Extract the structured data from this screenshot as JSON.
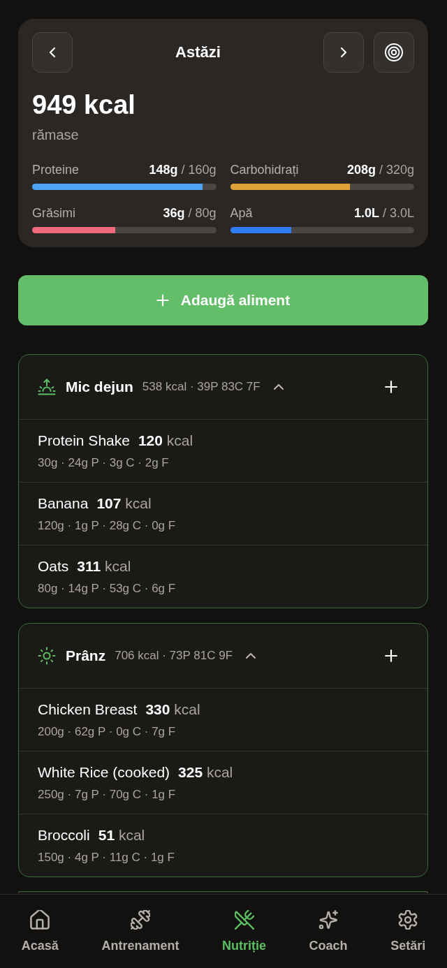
{
  "header": {
    "title": "Astăzi",
    "calories_remaining": "949 kcal",
    "remaining_label": "rămase"
  },
  "macros": [
    {
      "name": "Proteine",
      "value": "**148g** / 160g",
      "level": 0.925,
      "color": "#4da3f5"
    },
    {
      "name": "Carbohidrați",
      "value": "**208g** / 320g",
      "level": 0.65,
      "color": "#e1a237"
    },
    {
      "name": "Grăsimi",
      "value": "**36g** / 80g",
      "level": 0.45,
      "color": "#f2687d"
    },
    {
      "name": "Apă",
      "value": "**1.0L** / 3.0L",
      "level": 0.333,
      "color": "#2f7cf6"
    }
  ],
  "add_button": {
    "label": "Adaugă aliment"
  },
  "meals": [
    {
      "kind": "breakfast",
      "name": "Mic dejun",
      "summary": "538 kcal · 39P 83C 7F",
      "expanded": true,
      "items": [
        {
          "name": "Protein Shake",
          "calories": "**120** kcal",
          "details": "30g · 24g P · 3g C · 2g F"
        },
        {
          "name": "Banana",
          "calories": "**107** kcal",
          "details": "120g · 1g P · 28g C · 0g F"
        },
        {
          "name": "Oats",
          "calories": "**311** kcal",
          "details": "80g · 14g P · 53g C · 6g F"
        }
      ]
    },
    {
      "kind": "lunch",
      "name": "Prânz",
      "summary": "706 kcal · 73P 81C 9F",
      "expanded": true,
      "items": [
        {
          "name": "Chicken Breast",
          "calories": "**330** kcal",
          "details": "200g · 62g P · 0g C · 7g F"
        },
        {
          "name": "White Rice (cooked)",
          "calories": "**325** kcal",
          "details": "250g · 7g P · 70g C · 1g F"
        },
        {
          "name": "Broccoli",
          "calories": "**51** kcal",
          "details": "150g · 4g P · 11g C · 1g F"
        }
      ]
    }
  ],
  "nav": [
    {
      "kind": "home",
      "label": "Acasă",
      "selected": false
    },
    {
      "kind": "workout",
      "label": "Antrenament",
      "selected": false
    },
    {
      "kind": "nutrition",
      "label": "Nutriție",
      "selected": true
    },
    {
      "kind": "coach",
      "label": "Coach",
      "selected": false
    },
    {
      "kind": "settings",
      "label": "Setări",
      "selected": false
    }
  ]
}
